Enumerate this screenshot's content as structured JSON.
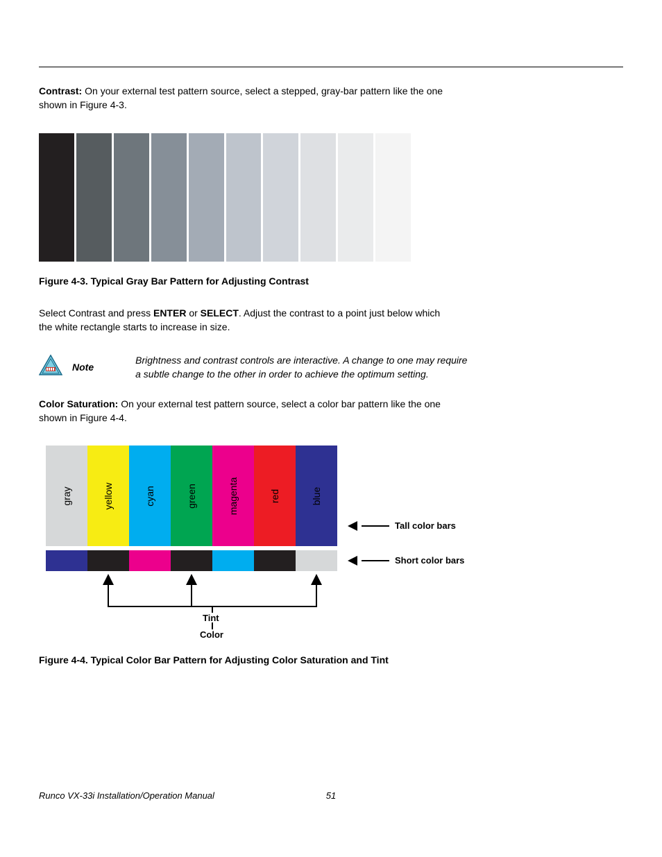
{
  "contrast": {
    "heading": "Contrast:",
    "text": " On your external test pattern source, select a stepped, gray-bar pattern like the one shown in Figure 4-3."
  },
  "gray_bars": {
    "colors": [
      "#231f20",
      "#565c5f",
      "#6e767c",
      "#868f98",
      "#a3abb5",
      "#bec4cc",
      "#d0d4da",
      "#dee0e3",
      "#eaebec",
      "#f4f4f4",
      "#ffffff"
    ]
  },
  "fig43_caption": "Figure 4-3. Typical Gray Bar Pattern for Adjusting Contrast",
  "contrast_instr": {
    "pre": "Select Contrast and press ",
    "b1": "ENTER",
    "mid": " or ",
    "b2": "SELECT",
    "post": ". Adjust the contrast to a point just below which the white rectangle starts to increase in size."
  },
  "note": {
    "label": "Note",
    "text": "Brightness and contrast controls are interactive. A change to one may require a subtle change to the other in order to achieve the optimum setting."
  },
  "saturation": {
    "heading": "Color Saturation:",
    "text": " On your external test pattern source, select a color bar pattern like the one shown in Figure 4-4."
  },
  "color_bars": {
    "tall": [
      {
        "label": "gray",
        "bg": "#d6d8d9",
        "fg": "#000"
      },
      {
        "label": "yellow",
        "bg": "#f7ec13",
        "fg": "#000"
      },
      {
        "label": "cyan",
        "bg": "#00adef",
        "fg": "#000"
      },
      {
        "label": "green",
        "bg": "#00a551",
        "fg": "#000"
      },
      {
        "label": "magenta",
        "bg": "#ec008c",
        "fg": "#000"
      },
      {
        "label": "red",
        "bg": "#ed1c24",
        "fg": "#000"
      },
      {
        "label": "blue",
        "bg": "#2e3192",
        "fg": "#000"
      }
    ],
    "short": [
      "#2e3192",
      "#231f20",
      "#ec008c",
      "#231f20",
      "#00adef",
      "#231f20",
      "#d6d8d9"
    ],
    "side_tall": "Tall color bars",
    "side_short": "Short color bars",
    "tint_label": "Tint",
    "color_label": "Color"
  },
  "fig44_caption": "Figure 4-4. Typical Color Bar Pattern for Adjusting Color Saturation and Tint",
  "footer": {
    "title": "Runco VX-33i Installation/Operation Manual",
    "page": "51"
  }
}
